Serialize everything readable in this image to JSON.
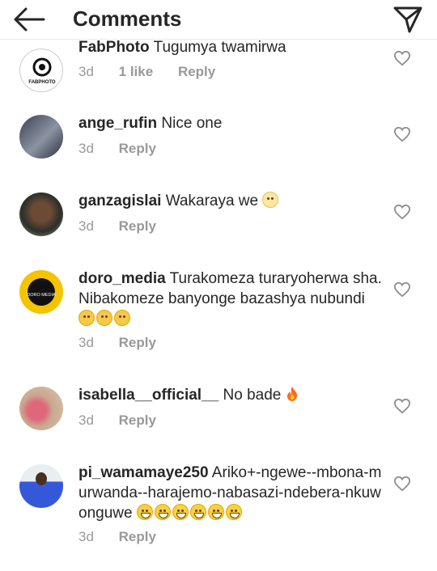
{
  "header": {
    "title": "Comments",
    "back_icon": "arrow-left-icon",
    "share_icon": "send-icon"
  },
  "comments": [
    {
      "user": "FabPhoto",
      "text": "Tugumya twamirwa",
      "time": "3d",
      "likes": "1 like",
      "reply": "Reply",
      "avatar_label": "FABPHOTO"
    },
    {
      "user": "ange_rufin",
      "text": "Nice one",
      "time": "3d",
      "reply": "Reply"
    },
    {
      "user": "ganzagislai",
      "text": "Wakaraya we",
      "time": "3d",
      "reply": "Reply"
    },
    {
      "user": "doro_media",
      "text": "Turakomeza turaryoherwa sha. Nibakomeze banyonge bazashya nubundi",
      "time": "3d",
      "reply": "Reply",
      "avatar_label": "DORO MEDIA"
    },
    {
      "user": "isabella__official__",
      "text": "No bade",
      "time": "3d",
      "reply": "Reply"
    },
    {
      "user": "pi_wamamaye250",
      "text": "Ariko+-ngewe--mbona-murwanda--harajemo-nabasazi-ndebera-nkuwonguwe",
      "time": "3d",
      "reply": "Reply"
    }
  ]
}
